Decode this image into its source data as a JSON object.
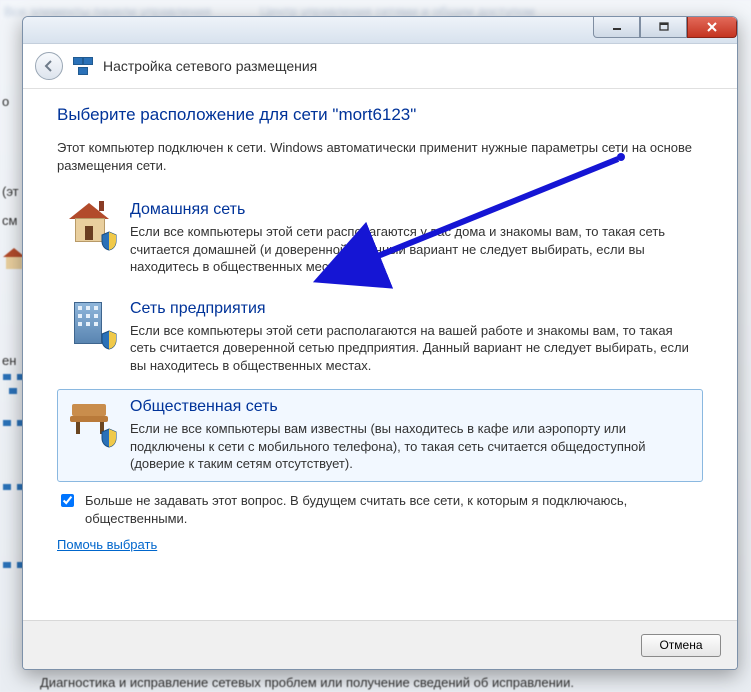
{
  "bg": {
    "breadcrumb_left": "Все элементы панели управления",
    "breadcrumb_right": "Центр управления сетями и общим доступом",
    "bottom_text": "Диагностика и исправление сетевых проблем или получение сведений об исправлении."
  },
  "titlebar": {},
  "header": {
    "title": "Настройка сетевого размещения"
  },
  "main": {
    "heading": "Выберите расположение для сети \"mort6123\"",
    "intro": "Этот компьютер подключен к сети. Windows автоматически применит нужные параметры сети на основе размещения сети."
  },
  "options": [
    {
      "title": "Домашняя сеть",
      "desc": "Если все компьютеры этой сети располагаются у вас дома и знакомы вам, то такая сеть считается домашней (и доверенной). Данный вариант не следует выбирать, если вы находитесь в общественных местах."
    },
    {
      "title": "Сеть предприятия",
      "desc": "Если все компьютеры этой сети располагаются на вашей работе и знакомы вам, то такая сеть считается доверенной сетью предприятия. Данный вариант не следует выбирать, если вы находитесь в общественных местах."
    },
    {
      "title": "Общественная сеть",
      "desc": "Если не все компьютеры вам известны (вы находитесь в кафе или аэропорту или подключены к сети с мобильного телефона), то такая сеть считается общедоступной (доверие к таким сетям отсутствует)."
    }
  ],
  "checkbox": "Больше не задавать этот вопрос. В будущем считать все сети, к которым я подключаюсь, общественными.",
  "help_link": "Помочь выбрать",
  "footer": {
    "cancel": "Отмена"
  }
}
